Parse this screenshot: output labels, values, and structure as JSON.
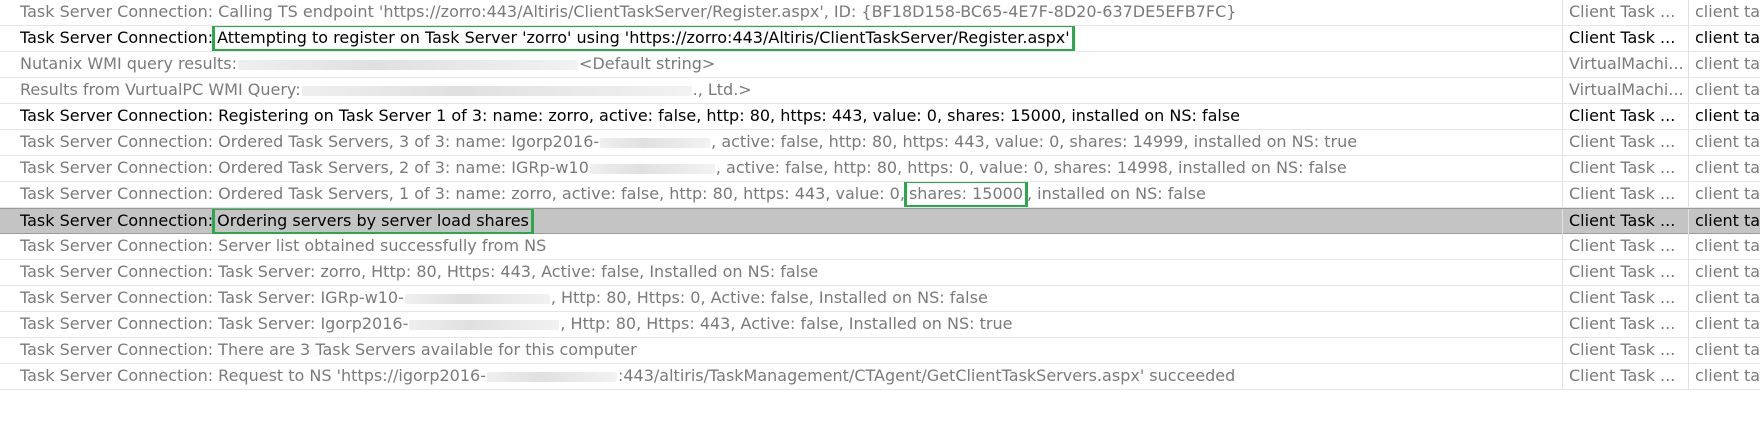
{
  "colors": {
    "highlight_border": "#2aa84a",
    "selected_row_bg": "#c4c4c4",
    "muted_text": "#7a7a7a"
  },
  "rows": [
    {
      "segs": [
        {
          "t": "Task Server Connection: Calling TS endpoint 'https://zorro:443/Altiris/ClientTaskServer/Register.aspx', ID: {BF18D158-BC65-4E7F-8D20-637DE5EFB7FC}"
        }
      ],
      "col2": "Client Task ...",
      "col3": "client task",
      "style": "gray"
    },
    {
      "segs": [
        {
          "t": "Task Server Connection:"
        },
        {
          "t": "Attempting to register on Task Server 'zorro' using 'https://zorro:443/Altiris/ClientTaskServer/Register.aspx'",
          "hl": true
        }
      ],
      "col2": "Client Task ...",
      "col3": "client task",
      "style": "black"
    },
    {
      "segs": [
        {
          "t": "Nutanix WMI query results: "
        },
        {
          "redact": 340
        },
        {
          "t": " <Default string>"
        }
      ],
      "col2": "VirtualMachi...",
      "col3": "client task",
      "style": "gray"
    },
    {
      "segs": [
        {
          "t": "Results from VurtualPC WMI Query: "
        },
        {
          "redact": 390
        },
        {
          "t": "., Ltd.>"
        }
      ],
      "col2": "VirtualMachi...",
      "col3": "client task",
      "style": "gray"
    },
    {
      "segs": [
        {
          "t": "Task Server Connection: Registering on Task Server 1 of 3: name: zorro, active: false, http: 80, https: 443, value: 0, shares: 15000, installed on NS: false"
        }
      ],
      "col2": "Client Task ...",
      "col3": "client task",
      "style": "black"
    },
    {
      "segs": [
        {
          "t": "Task Server Connection: Ordered Task Servers, 3 of 3: name: Igorp2016-"
        },
        {
          "redact": 110
        },
        {
          "t": ", active: false, http: 80, https: 443, value: 0, shares: 14999, installed on NS: true"
        }
      ],
      "col2": "Client Task ...",
      "col3": "client task",
      "style": "gray"
    },
    {
      "segs": [
        {
          "t": "Task Server Connection: Ordered Task Servers, 2 of 3: name: IGRp-w10"
        },
        {
          "redact": 125
        },
        {
          "t": ", active: false, http: 80, https: 0, value: 0, shares: 14998, installed on NS: false"
        }
      ],
      "col2": "Client Task ...",
      "col3": "client task",
      "style": "gray"
    },
    {
      "segs": [
        {
          "t": "Task Server Connection: Ordered Task Servers, 1 of 3: name: zorro, active: false, http: 80, https: 443, value: 0,"
        },
        {
          "t": "shares: 15000",
          "hl": true
        },
        {
          "t": ", installed on NS: false"
        }
      ],
      "col2": "Client Task ...",
      "col3": "client task",
      "style": "gray"
    },
    {
      "segs": [
        {
          "t": "Task Server Connection:"
        },
        {
          "t": "Ordering servers by server load shares",
          "hl": true
        }
      ],
      "col2": "Client Task ...",
      "col3": "client task",
      "style": "black",
      "selected": true
    },
    {
      "segs": [
        {
          "t": "Task Server Connection: Server list obtained successfully from NS"
        }
      ],
      "col2": "Client Task ...",
      "col3": "client task",
      "style": "gray"
    },
    {
      "segs": [
        {
          "t": "Task Server Connection: Task Server: zorro, Http: 80, Https: 443, Active: false, Installed on NS: false"
        }
      ],
      "col2": "Client Task ...",
      "col3": "client task",
      "style": "gray"
    },
    {
      "segs": [
        {
          "t": "Task Server Connection: Task Server: IGRp-w10-"
        },
        {
          "redact": 145
        },
        {
          "t": ", Http: 80, Https: 0, Active: false, Installed on NS: false"
        }
      ],
      "col2": "Client Task ...",
      "col3": "client task",
      "style": "gray"
    },
    {
      "segs": [
        {
          "t": "Task Server Connection: Task Server: Igorp2016-"
        },
        {
          "redact": 150
        },
        {
          "t": ", Http: 80, Https: 443, Active: false, Installed on NS: true"
        }
      ],
      "col2": "Client Task ...",
      "col3": "client task",
      "style": "gray"
    },
    {
      "segs": [
        {
          "t": "Task Server Connection: There are 3 Task Servers available for this computer"
        }
      ],
      "col2": "Client Task ...",
      "col3": "client task",
      "style": "gray"
    },
    {
      "segs": [
        {
          "t": "Task Server Connection: Request to NS 'https://igorp2016-"
        },
        {
          "redact": 130
        },
        {
          "t": ":443/altiris/TaskManagement/CTAgent/GetClientTaskServers.aspx' succeeded"
        }
      ],
      "col2": "Client Task ...",
      "col3": "client task",
      "style": "gray"
    }
  ]
}
